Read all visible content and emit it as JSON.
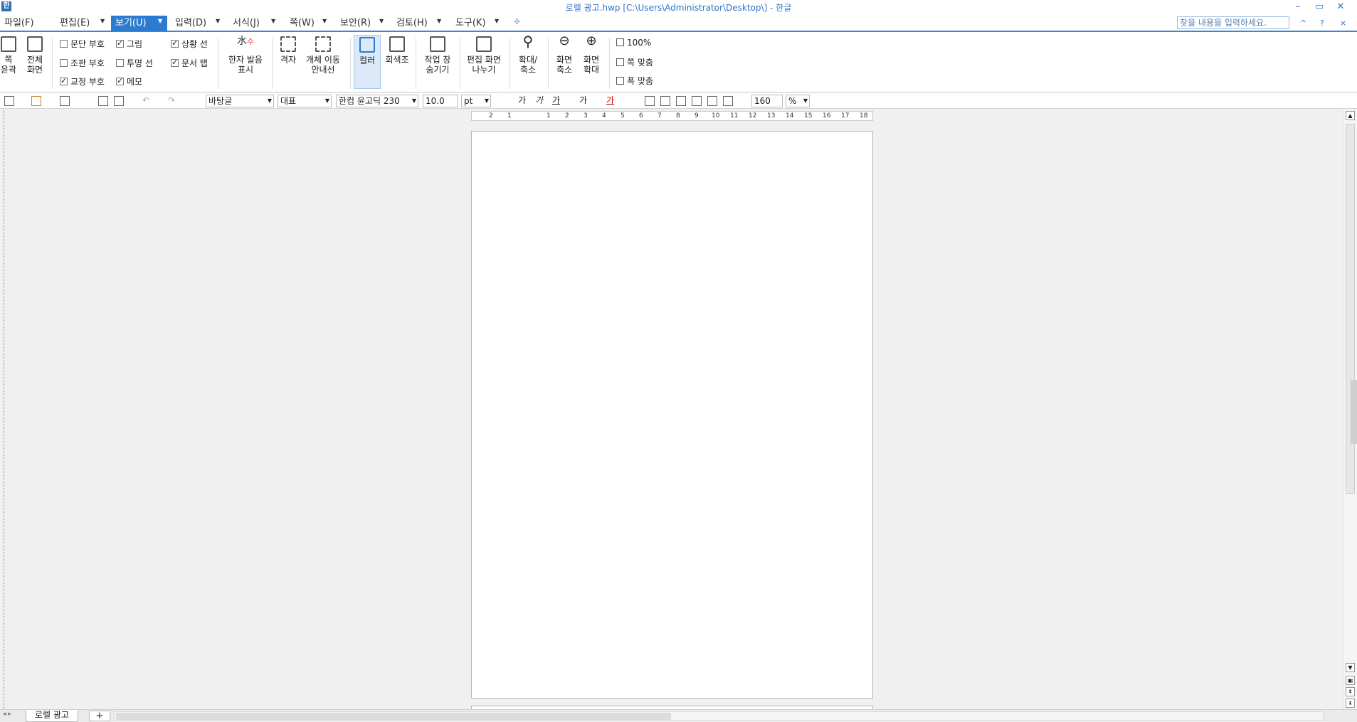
{
  "window": {
    "title": "로렐 광고.hwp [C:\\Users\\Administrator\\Desktop\\] - 한글",
    "app_icon_glyph": "한",
    "controls": [
      "–",
      "▭",
      "✕"
    ]
  },
  "menu": {
    "items": [
      {
        "label": "파일(F)"
      },
      {
        "label": "편집(E)"
      },
      {
        "label": "보기(U)"
      },
      {
        "label": "입력(D)"
      },
      {
        "label": "서식(J)"
      },
      {
        "label": "쪽(W)"
      },
      {
        "label": "보안(R)"
      },
      {
        "label": "검토(H)"
      },
      {
        "label": "도구(K)"
      }
    ],
    "active": "보기(U)",
    "search_placeholder": "찾을 내용을 입력하세요.",
    "mini_controls": [
      "^",
      "?",
      "×"
    ]
  },
  "ribbon": {
    "buttons": {
      "outline": "쪽\n윤곽",
      "fullscreen": "전체\n화면",
      "hanja": "한자 발음\n표시",
      "grid": "격자",
      "obj_nav": "개체 이동\n안내선",
      "color": "컬러",
      "gray": "회색조",
      "task_pane": "작업 창\n숨기기",
      "split": "편집 화면\n나누기",
      "zoom_toggle": "확대/\n축소",
      "zoom_out": "화면\n축소",
      "zoom_in": "화면\n확대"
    },
    "checkboxes": [
      {
        "label": "문단 부호",
        "checked": false
      },
      {
        "label": "조판 부호",
        "checked": false
      },
      {
        "label": "교정 부호",
        "checked": true
      },
      {
        "label": "그림",
        "checked": true
      },
      {
        "label": "투명 선",
        "checked": false
      },
      {
        "label": "메모",
        "checked": true
      },
      {
        "label": "상황 선",
        "checked": true
      },
      {
        "label": "문서 탭",
        "checked": true
      }
    ],
    "zoom_options": [
      "100%",
      "쪽 맞춤",
      "폭 맞춤"
    ]
  },
  "toolbar": {
    "style": "바탕글",
    "lang": "대표",
    "font": "한컴 윤고딕 230",
    "size": "10.0",
    "unit": "pt",
    "zoom": "160",
    "zoom_unit": "%",
    "format_glyphs": [
      "가",
      "가",
      "가",
      "가",
      "가"
    ]
  },
  "ruler": {
    "ticks": [
      "2",
      "1",
      "1",
      "2",
      "3",
      "4",
      "5",
      "6",
      "7",
      "8",
      "9",
      "10",
      "11",
      "12",
      "13",
      "14",
      "15",
      "16",
      "17",
      "18"
    ]
  },
  "document": {
    "lines": [
      "",
      "",
      "",
      "",
      "",
      "",
      "",
      "",
      "",
      "",
      "",
      "",
      "",
      "",
      "",
      "",
      "",
      "",
      "",
      ""
    ]
  },
  "status": {
    "doc_tab": "로렐 광고",
    "add_tab": "+"
  }
}
